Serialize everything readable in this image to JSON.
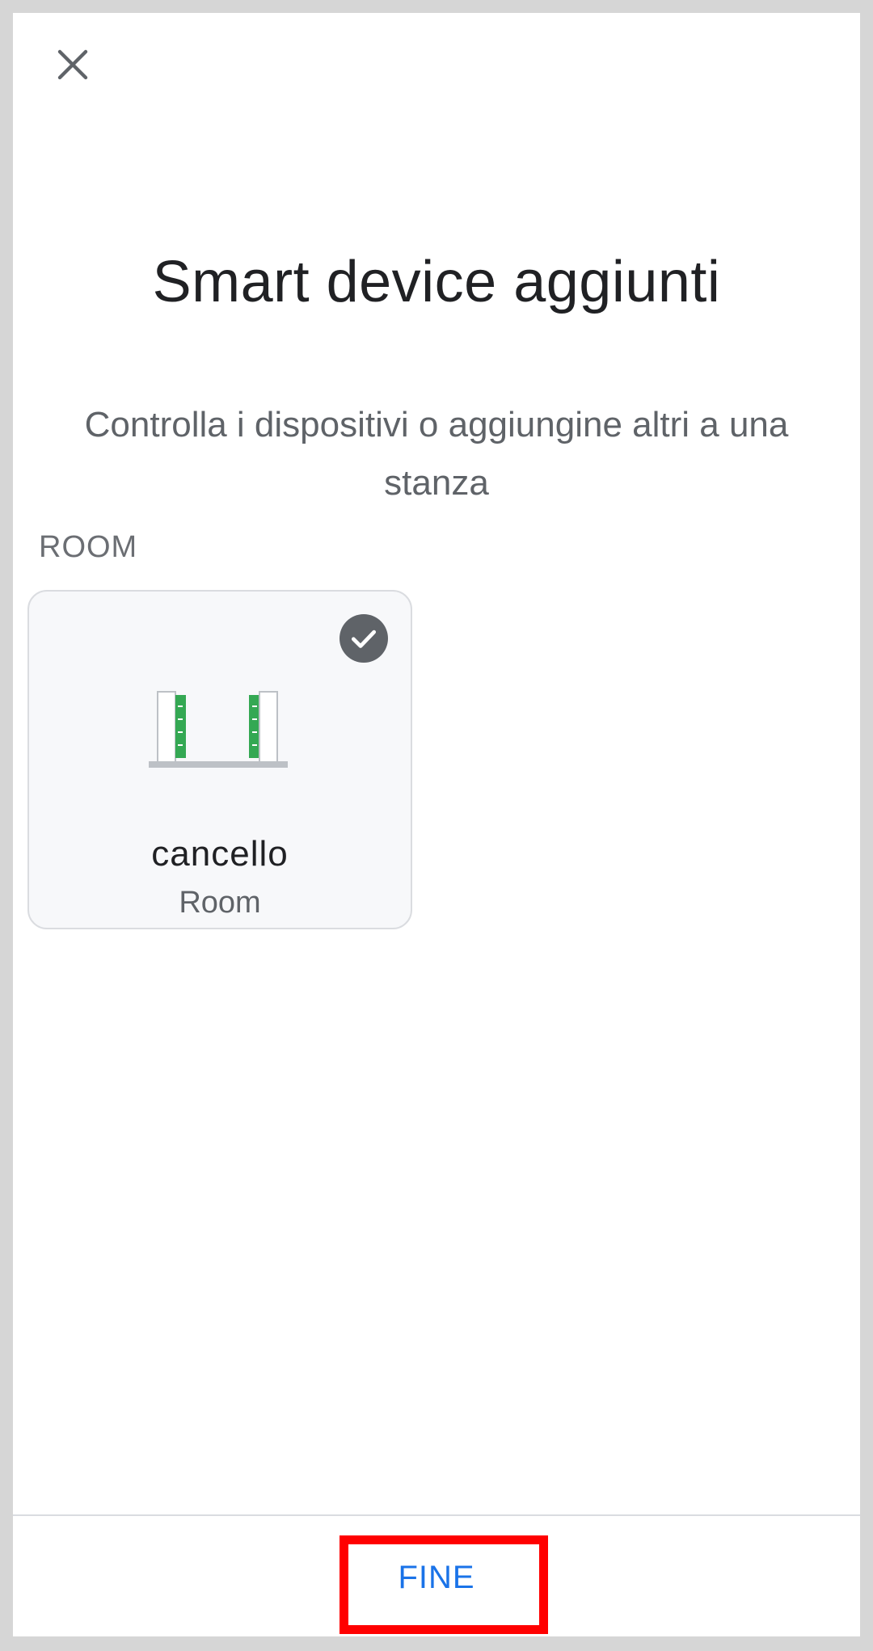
{
  "header": {
    "close_icon": "close-icon"
  },
  "main": {
    "title": "Smart device aggiunti",
    "subtitle": "Controlla i dispositivi o aggiungine altri a una stanza",
    "section_label": "ROOM"
  },
  "room_card": {
    "name": "cancello",
    "subtitle": "Room",
    "selected": true,
    "check_icon": "check-circle-icon",
    "illustration_icon": "gate-icon"
  },
  "footer": {
    "done_label": "FINE"
  },
  "colors": {
    "accent": "#1a73e8",
    "gate_green": "#34a853",
    "badge": "#5f6368",
    "highlight": "#ff0000"
  }
}
